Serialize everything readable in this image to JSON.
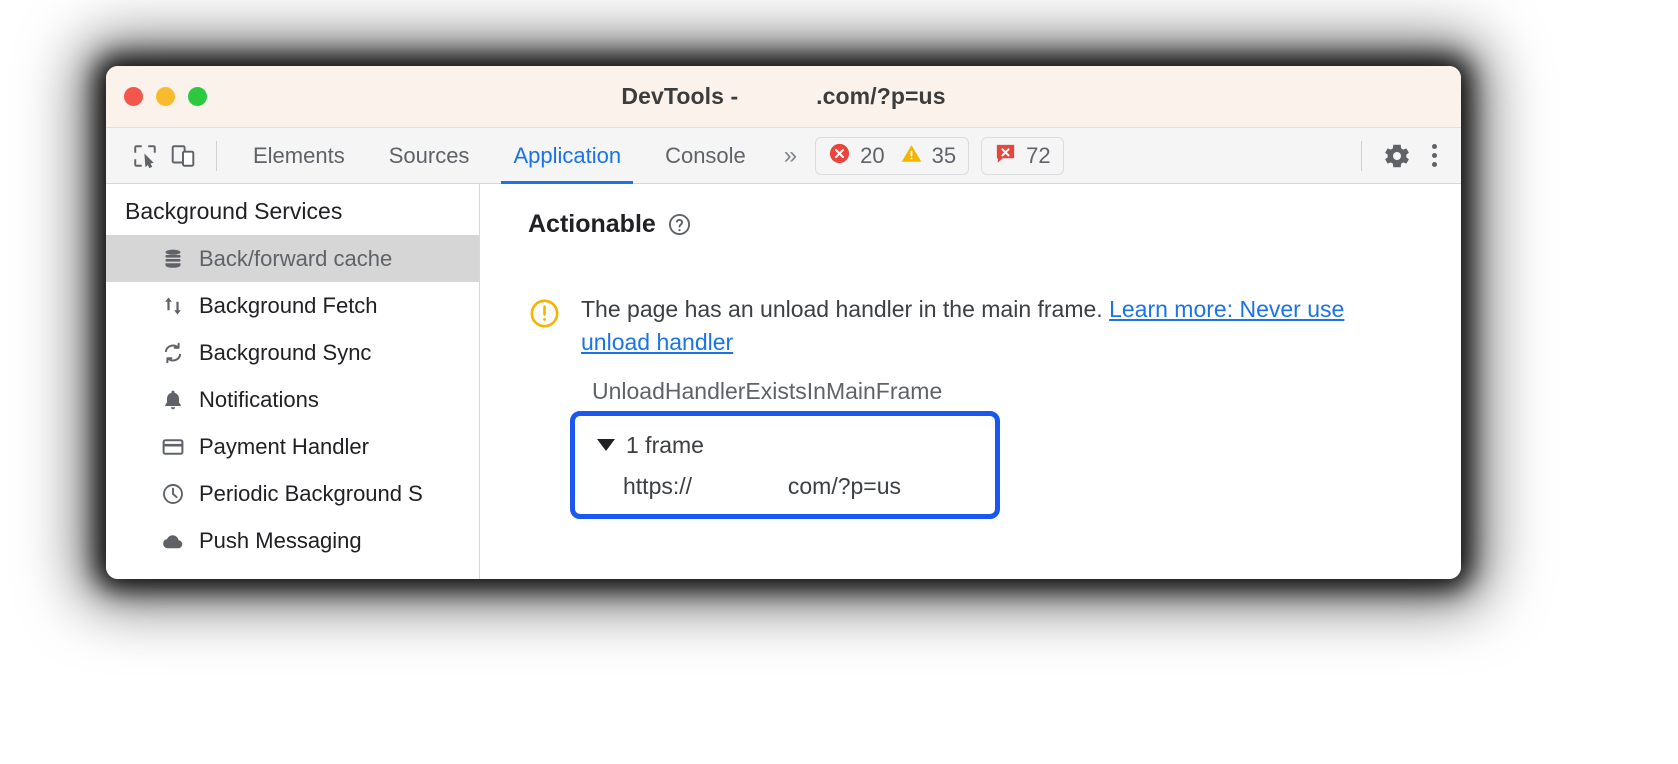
{
  "window": {
    "title": "DevTools -            .com/?p=us",
    "traffic_lights": [
      "close-red",
      "minimize-yellow",
      "maximize-green"
    ]
  },
  "toolbar": {
    "inspect_icon": "inspect-cursor-icon",
    "device_icon": "device-toolbar-icon",
    "tabs": [
      {
        "label": "Elements",
        "active": false
      },
      {
        "label": "Sources",
        "active": false
      },
      {
        "label": "Application",
        "active": true
      },
      {
        "label": "Console",
        "active": false
      }
    ],
    "overflow_label": "»",
    "badges": [
      {
        "name": "errors",
        "icon": "error-circle-icon",
        "count": "20",
        "color": "#e8453c"
      },
      {
        "name": "warnings",
        "icon": "warning-triangle-icon",
        "count": "35",
        "color": "#f5b400"
      },
      {
        "name": "issues",
        "icon": "issue-message-icon",
        "count": "72",
        "color": "#e8453c"
      }
    ],
    "settings_icon": "gear-icon",
    "more_icon": "kebab-menu-icon"
  },
  "sidebar": {
    "header": "Background Services",
    "items": [
      {
        "label": "Back/forward cache",
        "icon": "database-icon",
        "selected": true
      },
      {
        "label": "Background Fetch",
        "icon": "up-down-arrows-icon",
        "selected": false
      },
      {
        "label": "Background Sync",
        "icon": "sync-arrows-icon",
        "selected": false
      },
      {
        "label": "Notifications",
        "icon": "bell-icon",
        "selected": false
      },
      {
        "label": "Payment Handler",
        "icon": "credit-card-icon",
        "selected": false
      },
      {
        "label": "Periodic Background S",
        "icon": "clock-icon",
        "selected": false
      },
      {
        "label": "Push Messaging",
        "icon": "cloud-icon",
        "selected": false
      }
    ]
  },
  "main": {
    "panel_title": "Actionable",
    "help_icon": "help-circle-icon",
    "issue": {
      "icon": "warning-circle-exclamation-icon",
      "message": "The page has an unload handler in the main frame. ",
      "link_text": "Learn more: Never use unload handler",
      "reason_code": "UnloadHandlerExistsInMainFrame"
    },
    "frames": {
      "toggle_icon": "triangle-down-icon",
      "summary": "1 frame",
      "url": "https://               com/?p=us"
    }
  },
  "colors": {
    "accent": "#1a73e8",
    "highlight_border": "#1a56f0",
    "warning": "#f5b400",
    "error": "#e8453c",
    "titlebar": "#fbf2ec"
  }
}
